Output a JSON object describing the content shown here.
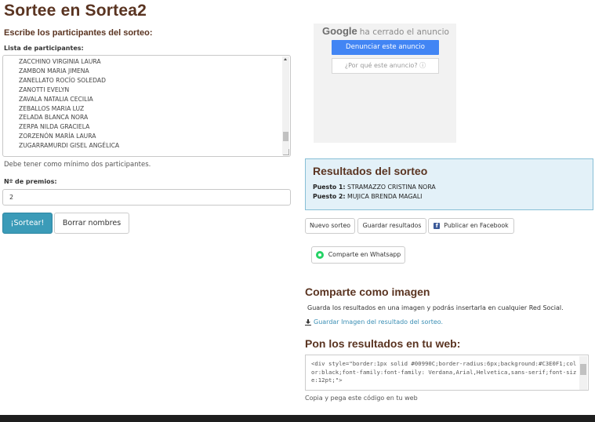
{
  "title": "Sortee en Sortea2",
  "form": {
    "section_title": "Escribe los participantes del sorteo:",
    "list_label": "Lista de participantes:",
    "participants": [
      "ZACCHINO VIRGINIA LAURA",
      "ZAMBON MARIA JIMENA",
      "ZANELLATO ROCÍO SOLEDAD",
      "ZANOTTI EVELYN",
      "ZAVALA NATALIA CECILIA",
      "ZEBALLOS MARIA LUZ",
      "ZELADA BLANCA NORA",
      "ZERPA NILDA GRACIELA",
      "ZORZENÓN MARÍA LAURA",
      "ZUGARRAMURDI GISEL ANGÉLICA"
    ],
    "min_help": "Debe tener como mínimo dos participantes.",
    "prizes_label": "Nº de premios:",
    "prizes_value": "2",
    "draw_button": "¡Sortear!",
    "clear_button": "Borrar nombres"
  },
  "ad": {
    "google": "Google",
    "closed_text": "ha cerrado el anuncio",
    "report_button": "Denunciar este anuncio",
    "why_button": "¿Por qué este anuncio? ⓘ"
  },
  "results": {
    "title": "Resultados del sorteo",
    "items": [
      {
        "position": "Puesto 1:",
        "name": "STRAMAZZO CRISTINA NORA"
      },
      {
        "position": "Puesto 2:",
        "name": "MUJICA BRENDA MAGALI"
      }
    ],
    "new_draw_button": "Nuevo sorteo",
    "save_button": "Guardar resultados",
    "facebook_button": "Publicar en Facebook",
    "whatsapp_button": "Comparte en Whatsapp"
  },
  "share_image": {
    "title": "Comparte como imagen",
    "description": "Guarda los resultados en una imagen y podrás insertarla en cualquier Red Social.",
    "link": "Guardar Imagen del resultado del sorteo."
  },
  "embed": {
    "title": "Pon los resultados en tu web:",
    "code": "<div style=\"border:1px solid #00990C;border-radius:6px;background:#C3E0F1;color:black;font-family:font-family: Verdana,Arial,Helvetica,sans-serif;font-size:12pt;\">",
    "help": "Copia y pega este código en tu web"
  },
  "colors": {
    "brand_brown": "#5a3421",
    "primary_button": "#3b9bb8",
    "results_bg": "#e3f1f8",
    "link": "#3b8fb5"
  }
}
